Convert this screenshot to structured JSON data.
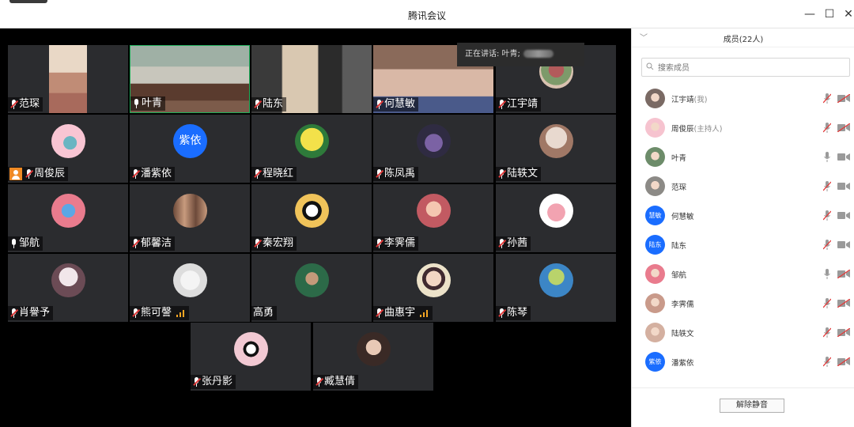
{
  "window": {
    "title": "腾讯会议",
    "minimize_glyph": "—",
    "maximize_glyph": "☐",
    "close_glyph": "✕"
  },
  "banner": {
    "label": "正在讲话: 叶青;"
  },
  "tiles": [
    {
      "name": "范琛",
      "muted": true
    },
    {
      "name": "叶青",
      "muted": false
    },
    {
      "name": "陆东",
      "muted": true
    },
    {
      "name": "何慧敏",
      "muted": true
    },
    {
      "name": "江宇靖",
      "muted": true
    },
    {
      "name": "周俊辰",
      "muted": true,
      "host": true
    },
    {
      "name": "潘紫依",
      "muted": true,
      "avatar_text": "紫依"
    },
    {
      "name": "程晓红",
      "muted": true
    },
    {
      "name": "陈凤禹",
      "muted": true
    },
    {
      "name": "陆轶文",
      "muted": true
    },
    {
      "name": "邹航",
      "muted": false
    },
    {
      "name": "郁馨洁",
      "muted": true
    },
    {
      "name": "秦宏翔",
      "muted": true
    },
    {
      "name": "李霁儒",
      "muted": true
    },
    {
      "name": "孙茜",
      "muted": true
    },
    {
      "name": "肖譽予",
      "muted": true
    },
    {
      "name": "熊可謦",
      "muted": true,
      "signal": true
    },
    {
      "name": "高勇",
      "muted": false,
      "no_mic": true
    },
    {
      "name": "曲惠宇",
      "muted": true,
      "signal": true
    },
    {
      "name": "陈琴",
      "muted": true
    },
    {
      "name": "张丹影",
      "muted": true
    },
    {
      "name": "臧慧倩",
      "muted": true
    }
  ],
  "panel": {
    "title": "成员(22人)",
    "search_placeholder": "搜索成员",
    "members": [
      {
        "name": "江宇靖",
        "role": "(我)",
        "mic_muted": true,
        "cam_off": true,
        "avatar_color": "#7a6a64"
      },
      {
        "name": "周俊辰",
        "role": "(主持人)",
        "mic_muted": true,
        "cam_off": true,
        "avatar_color": "#f6c3cf"
      },
      {
        "name": "叶青",
        "role": "",
        "mic_muted": false,
        "cam_off": false,
        "avatar_color": "#6d8c6a"
      },
      {
        "name": "范琛",
        "role": "",
        "mic_muted": true,
        "cam_off": false,
        "avatar_color": "#8c8a86"
      },
      {
        "name": "何慧敏",
        "role": "",
        "mic_muted": true,
        "cam_off": false,
        "avatar_text": "慧敏"
      },
      {
        "name": "陆东",
        "role": "",
        "mic_muted": true,
        "cam_off": false,
        "avatar_text": "陆东"
      },
      {
        "name": "邹航",
        "role": "",
        "mic_muted": false,
        "cam_off": true,
        "avatar_color": "#e97b8d"
      },
      {
        "name": "李霁儒",
        "role": "",
        "mic_muted": true,
        "cam_off": true,
        "avatar_color": "#c99a8a"
      },
      {
        "name": "陆轶文",
        "role": "",
        "mic_muted": true,
        "cam_off": true,
        "avatar_color": "#d4b0a0"
      },
      {
        "name": "潘紫依",
        "role": "",
        "mic_muted": true,
        "cam_off": true,
        "avatar_text": "紫依"
      }
    ],
    "unmute_label": "解除静音"
  }
}
